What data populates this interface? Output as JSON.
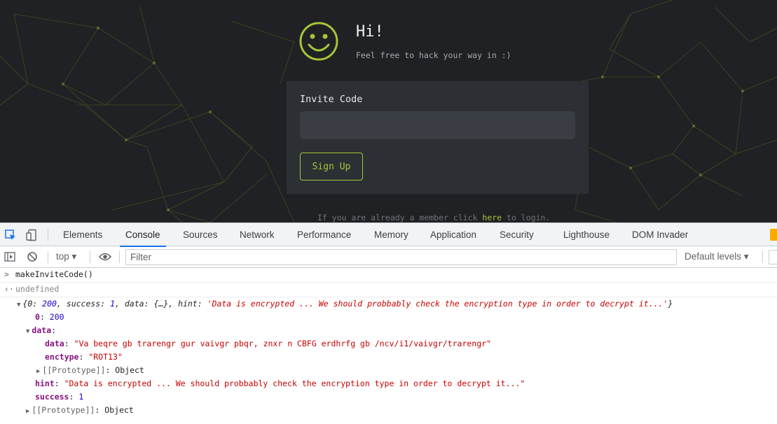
{
  "page": {
    "greeting": "Hi!",
    "subtitle": "Feel free to hack your way in :)",
    "invite_label": "Invite Code",
    "invite_value": "",
    "signup_label": "Sign Up",
    "login_prefix": "If you are already a member click ",
    "login_link": "here",
    "login_suffix": " to login.",
    "accent_color": "#a4c639"
  },
  "devtools": {
    "tabs": [
      "Elements",
      "Console",
      "Sources",
      "Network",
      "Performance",
      "Memory",
      "Application",
      "Security",
      "Lighthouse",
      "DOM Invader"
    ],
    "active_tab": "Console",
    "context": "top ▾",
    "filter_placeholder": "Filter",
    "levels": "Default levels ▾",
    "icons": [
      "inspect-element-icon",
      "device-toolbar-icon",
      "sidebar-toggle-icon",
      "clear-console-icon",
      "eye-icon"
    ]
  },
  "console": {
    "input": "makeInviteCode()",
    "result": "undefined",
    "object_summary_open": "{",
    "object_summary_0_key": "0: ",
    "object_summary_0_val": "200",
    "object_summary_success": ", success: ",
    "object_summary_success_val": "1",
    "object_summary_data": ", data: {…}, hint: ",
    "object_summary_hint": "'Data is encrypted ... We should probbably check the encryption type in order to decrypt it...'",
    "object_summary_close": "}",
    "key_0": "0",
    "val_0": "200",
    "key_data": "data",
    "key_data_data": "data",
    "val_data_data": "\"Va beqre gb trarengr gur vaivgr pbqr, znxr n CBFG erdhrfg gb /ncv/i1/vaivgr/trarengr\"",
    "key_enctype": "enctype",
    "val_enctype": "\"ROT13\"",
    "prototype_label": "[[Prototype]]",
    "prototype_value": "Object",
    "key_hint": "hint",
    "val_hint": "\"Data is encrypted ... We should probbably check the encryption type in order to decrypt it...\"",
    "key_success": "success",
    "val_success": "1"
  }
}
